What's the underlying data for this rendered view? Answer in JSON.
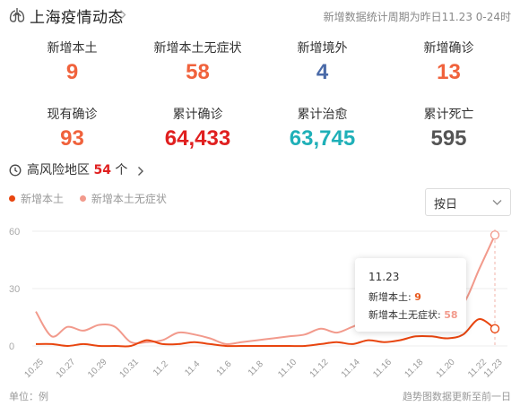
{
  "header": {
    "title": "上海疫情动态",
    "period": "新增数据统计周期为昨日11.23 0-24时"
  },
  "stats": [
    {
      "label": "新增本土",
      "value": "9",
      "color": "#f0623c"
    },
    {
      "label": "新增本土无症状",
      "value": "58",
      "color": "#f0623c"
    },
    {
      "label": "新增境外",
      "value": "4",
      "color": "#4a6aa8"
    },
    {
      "label": "新增确诊",
      "value": "13",
      "color": "#f0623c"
    },
    {
      "label": "现有确诊",
      "value": "93",
      "color": "#f0623c"
    },
    {
      "label": "累计确诊",
      "value": "64,433",
      "color": "#e02020"
    },
    {
      "label": "累计治愈",
      "value": "63,745",
      "color": "#1fb0b8"
    },
    {
      "label": "累计死亡",
      "value": "595",
      "color": "#555555"
    }
  ],
  "risk": {
    "prefix": "高风险地区",
    "count": "54",
    "suffix": "个"
  },
  "select": {
    "value": "按日"
  },
  "chart_data": {
    "type": "line",
    "x": [
      "10.25",
      "10.26",
      "10.27",
      "10.28",
      "10.29",
      "10.30",
      "10.31",
      "11.1",
      "11.2",
      "11.3",
      "11.4",
      "11.5",
      "11.6",
      "11.7",
      "11.8",
      "11.9",
      "11.10",
      "11.11",
      "11.12",
      "11.13",
      "11.14",
      "11.15",
      "11.16",
      "11.17",
      "11.18",
      "11.19",
      "11.20",
      "11.21",
      "11.22",
      "11.23"
    ],
    "xticks": [
      "10.25",
      "10.27",
      "10.29",
      "10.31",
      "11.2",
      "11.4",
      "11.6",
      "11.8",
      "11.10",
      "11.12",
      "11.14",
      "11.16",
      "11.18",
      "11.20",
      "11.22",
      "11.23"
    ],
    "yticks": [
      0,
      30,
      60
    ],
    "ylim": [
      0,
      60
    ],
    "series": [
      {
        "name": "新增本土",
        "color": "#e8450f",
        "values": [
          1,
          1,
          0,
          1,
          0,
          0,
          0,
          3,
          1,
          1,
          2,
          1,
          0,
          0,
          0,
          0,
          0,
          0,
          1,
          2,
          1,
          3,
          2,
          3,
          5,
          5,
          4,
          6,
          14,
          9
        ]
      },
      {
        "name": "新增本土无症状",
        "color": "#f29a8c",
        "values": [
          18,
          5,
          10,
          8,
          11,
          10,
          2,
          2,
          3,
          7,
          6,
          4,
          1,
          2,
          3,
          4,
          5,
          6,
          9,
          7,
          10,
          13,
          12,
          18,
          16,
          15,
          19,
          22,
          40,
          58
        ]
      }
    ],
    "tooltip": {
      "date": "11.23",
      "label1": "新增本土:",
      "value1": "9",
      "label2": "新增本土无症状:",
      "value2": "58"
    }
  },
  "footer": {
    "unit": "单位：例",
    "note": "趋势图数据更新至前一日"
  }
}
